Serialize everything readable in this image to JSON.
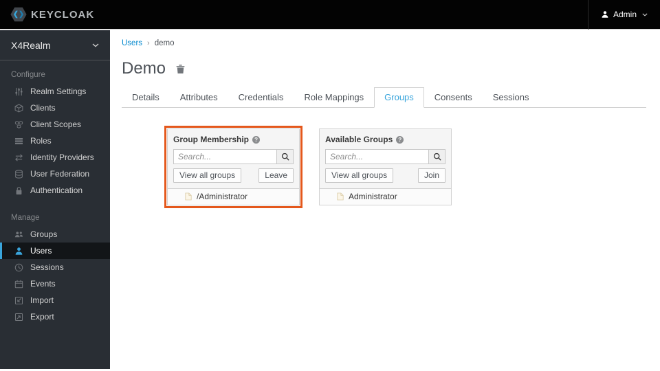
{
  "header": {
    "brand": "KEYCLOAK",
    "user_menu": {
      "label": "Admin"
    }
  },
  "sidebar": {
    "realm": "X4Realm",
    "sections": [
      {
        "label": "Configure",
        "items": [
          {
            "label": "Realm Settings",
            "icon": "sliders-icon"
          },
          {
            "label": "Clients",
            "icon": "cube-icon"
          },
          {
            "label": "Client Scopes",
            "icon": "cubes-icon"
          },
          {
            "label": "Roles",
            "icon": "list-icon"
          },
          {
            "label": "Identity Providers",
            "icon": "exchange-icon"
          },
          {
            "label": "User Federation",
            "icon": "database-icon"
          },
          {
            "label": "Authentication",
            "icon": "lock-icon"
          }
        ]
      },
      {
        "label": "Manage",
        "items": [
          {
            "label": "Groups",
            "icon": "group-icon"
          },
          {
            "label": "Users",
            "icon": "user-icon",
            "active": true
          },
          {
            "label": "Sessions",
            "icon": "clock-icon"
          },
          {
            "label": "Events",
            "icon": "calendar-icon"
          },
          {
            "label": "Import",
            "icon": "import-icon"
          },
          {
            "label": "Export",
            "icon": "export-icon"
          }
        ]
      }
    ]
  },
  "breadcrumb": {
    "items": [
      "Users",
      "demo"
    ],
    "separator": "›"
  },
  "page": {
    "title": "Demo"
  },
  "tabs": {
    "items": [
      "Details",
      "Attributes",
      "Credentials",
      "Role Mappings",
      "Groups",
      "Consents",
      "Sessions"
    ],
    "active": "Groups"
  },
  "panels": {
    "membership": {
      "title": "Group Membership",
      "search_placeholder": "Search...",
      "view_all_label": "View all groups",
      "action_label": "Leave",
      "items": [
        "/Administrator"
      ],
      "highlighted": true
    },
    "available": {
      "title": "Available Groups",
      "search_placeholder": "Search...",
      "view_all_label": "View all groups",
      "action_label": "Join",
      "items": [
        "Administrator"
      ]
    }
  },
  "colors": {
    "accent_blue": "#39a5dc",
    "link_blue": "#0088ce",
    "highlight_orange": "#e4581c",
    "sidebar_bg": "#292e34",
    "header_bg": "#030303"
  }
}
